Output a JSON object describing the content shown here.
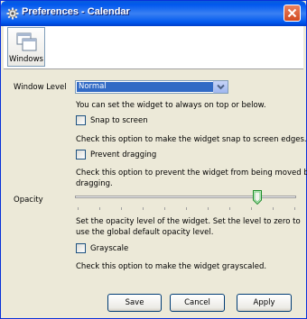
{
  "window": {
    "title": "Preferences - Calendar"
  },
  "toolbar": {
    "tabs": [
      {
        "label": "Windows",
        "icon": "windows-icon"
      }
    ]
  },
  "window_level": {
    "label": "Window Level",
    "selected": "Normal",
    "description": "You can set the widget to always on top or below."
  },
  "snap": {
    "label": "Snap to screen",
    "checked": false,
    "description": "Check this option to make the widget snap to screen edges."
  },
  "dragging": {
    "label": "Prevent dragging",
    "checked": false,
    "description_1": "Check this option to prevent the widget from being moved by",
    "description_2": "dragging."
  },
  "opacity": {
    "label": "Opacity",
    "level_fraction": 0.83,
    "description_1": "Set the opacity level of the widget. Set the level to zero to",
    "description_2": "use the global default opacity level."
  },
  "grayscale": {
    "label": "Grayscale",
    "checked": false,
    "description": "Check this option to make the widget grayscaled."
  },
  "buttons": {
    "save": "Save",
    "cancel": "Cancel",
    "apply": "Apply"
  },
  "colors": {
    "titlebar": "#0058ee",
    "selection": "#316ac5",
    "dialog_bg": "#ece9d8"
  }
}
